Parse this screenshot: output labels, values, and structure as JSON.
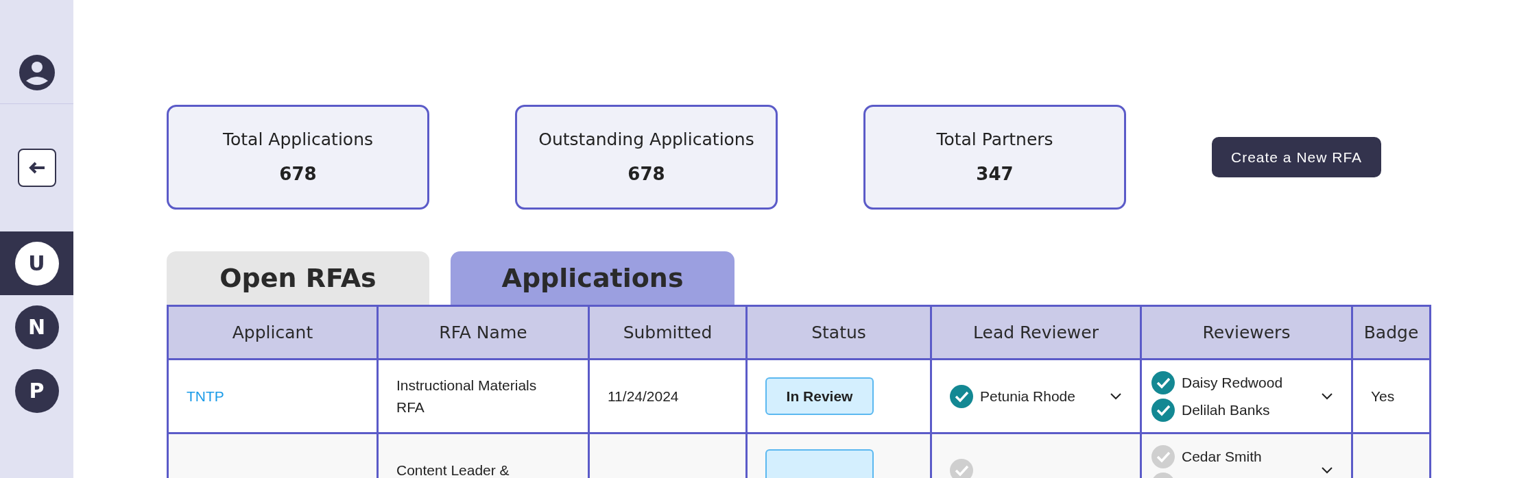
{
  "sidebar": {
    "items": [
      {
        "kind": "profile"
      },
      {
        "kind": "back"
      },
      {
        "kind": "letter",
        "label": "U",
        "selected": true
      },
      {
        "kind": "letter",
        "label": "N",
        "selected": false
      },
      {
        "kind": "letter",
        "label": "P",
        "selected": false
      }
    ]
  },
  "stats": [
    {
      "title": "Total Applications",
      "value": "678"
    },
    {
      "title": "Outstanding Applications",
      "value": "678"
    },
    {
      "title": "Total Partners",
      "value": "347"
    }
  ],
  "create_button": "Create a New RFA",
  "tabs": [
    {
      "label": "Open RFAs",
      "selected": false
    },
    {
      "label": "Applications",
      "selected": true
    }
  ],
  "table": {
    "columns": [
      "Applicant",
      "RFA Name",
      "Submitted",
      "Status",
      "Lead Reviewer",
      "Reviewers",
      "Badge"
    ],
    "rows": [
      {
        "applicant": "TNTP",
        "rfa_name": "Instructional Materials RFA",
        "submitted": "11/24/2024",
        "status": "In Review",
        "lead_reviewer": {
          "name": "Petunia Rhode",
          "done": true
        },
        "reviewers": [
          {
            "name": "Daisy Redwood",
            "done": true
          },
          {
            "name": "Delilah Banks",
            "done": true
          }
        ],
        "badge": "Yes"
      },
      {
        "rfa_name": "Content Leader &",
        "status_badge": true,
        "lead_reviewer": {
          "done": false
        },
        "reviewers": [
          {
            "name": "Cedar Smith",
            "done": false
          },
          {
            "done": false
          }
        ]
      }
    ]
  }
}
